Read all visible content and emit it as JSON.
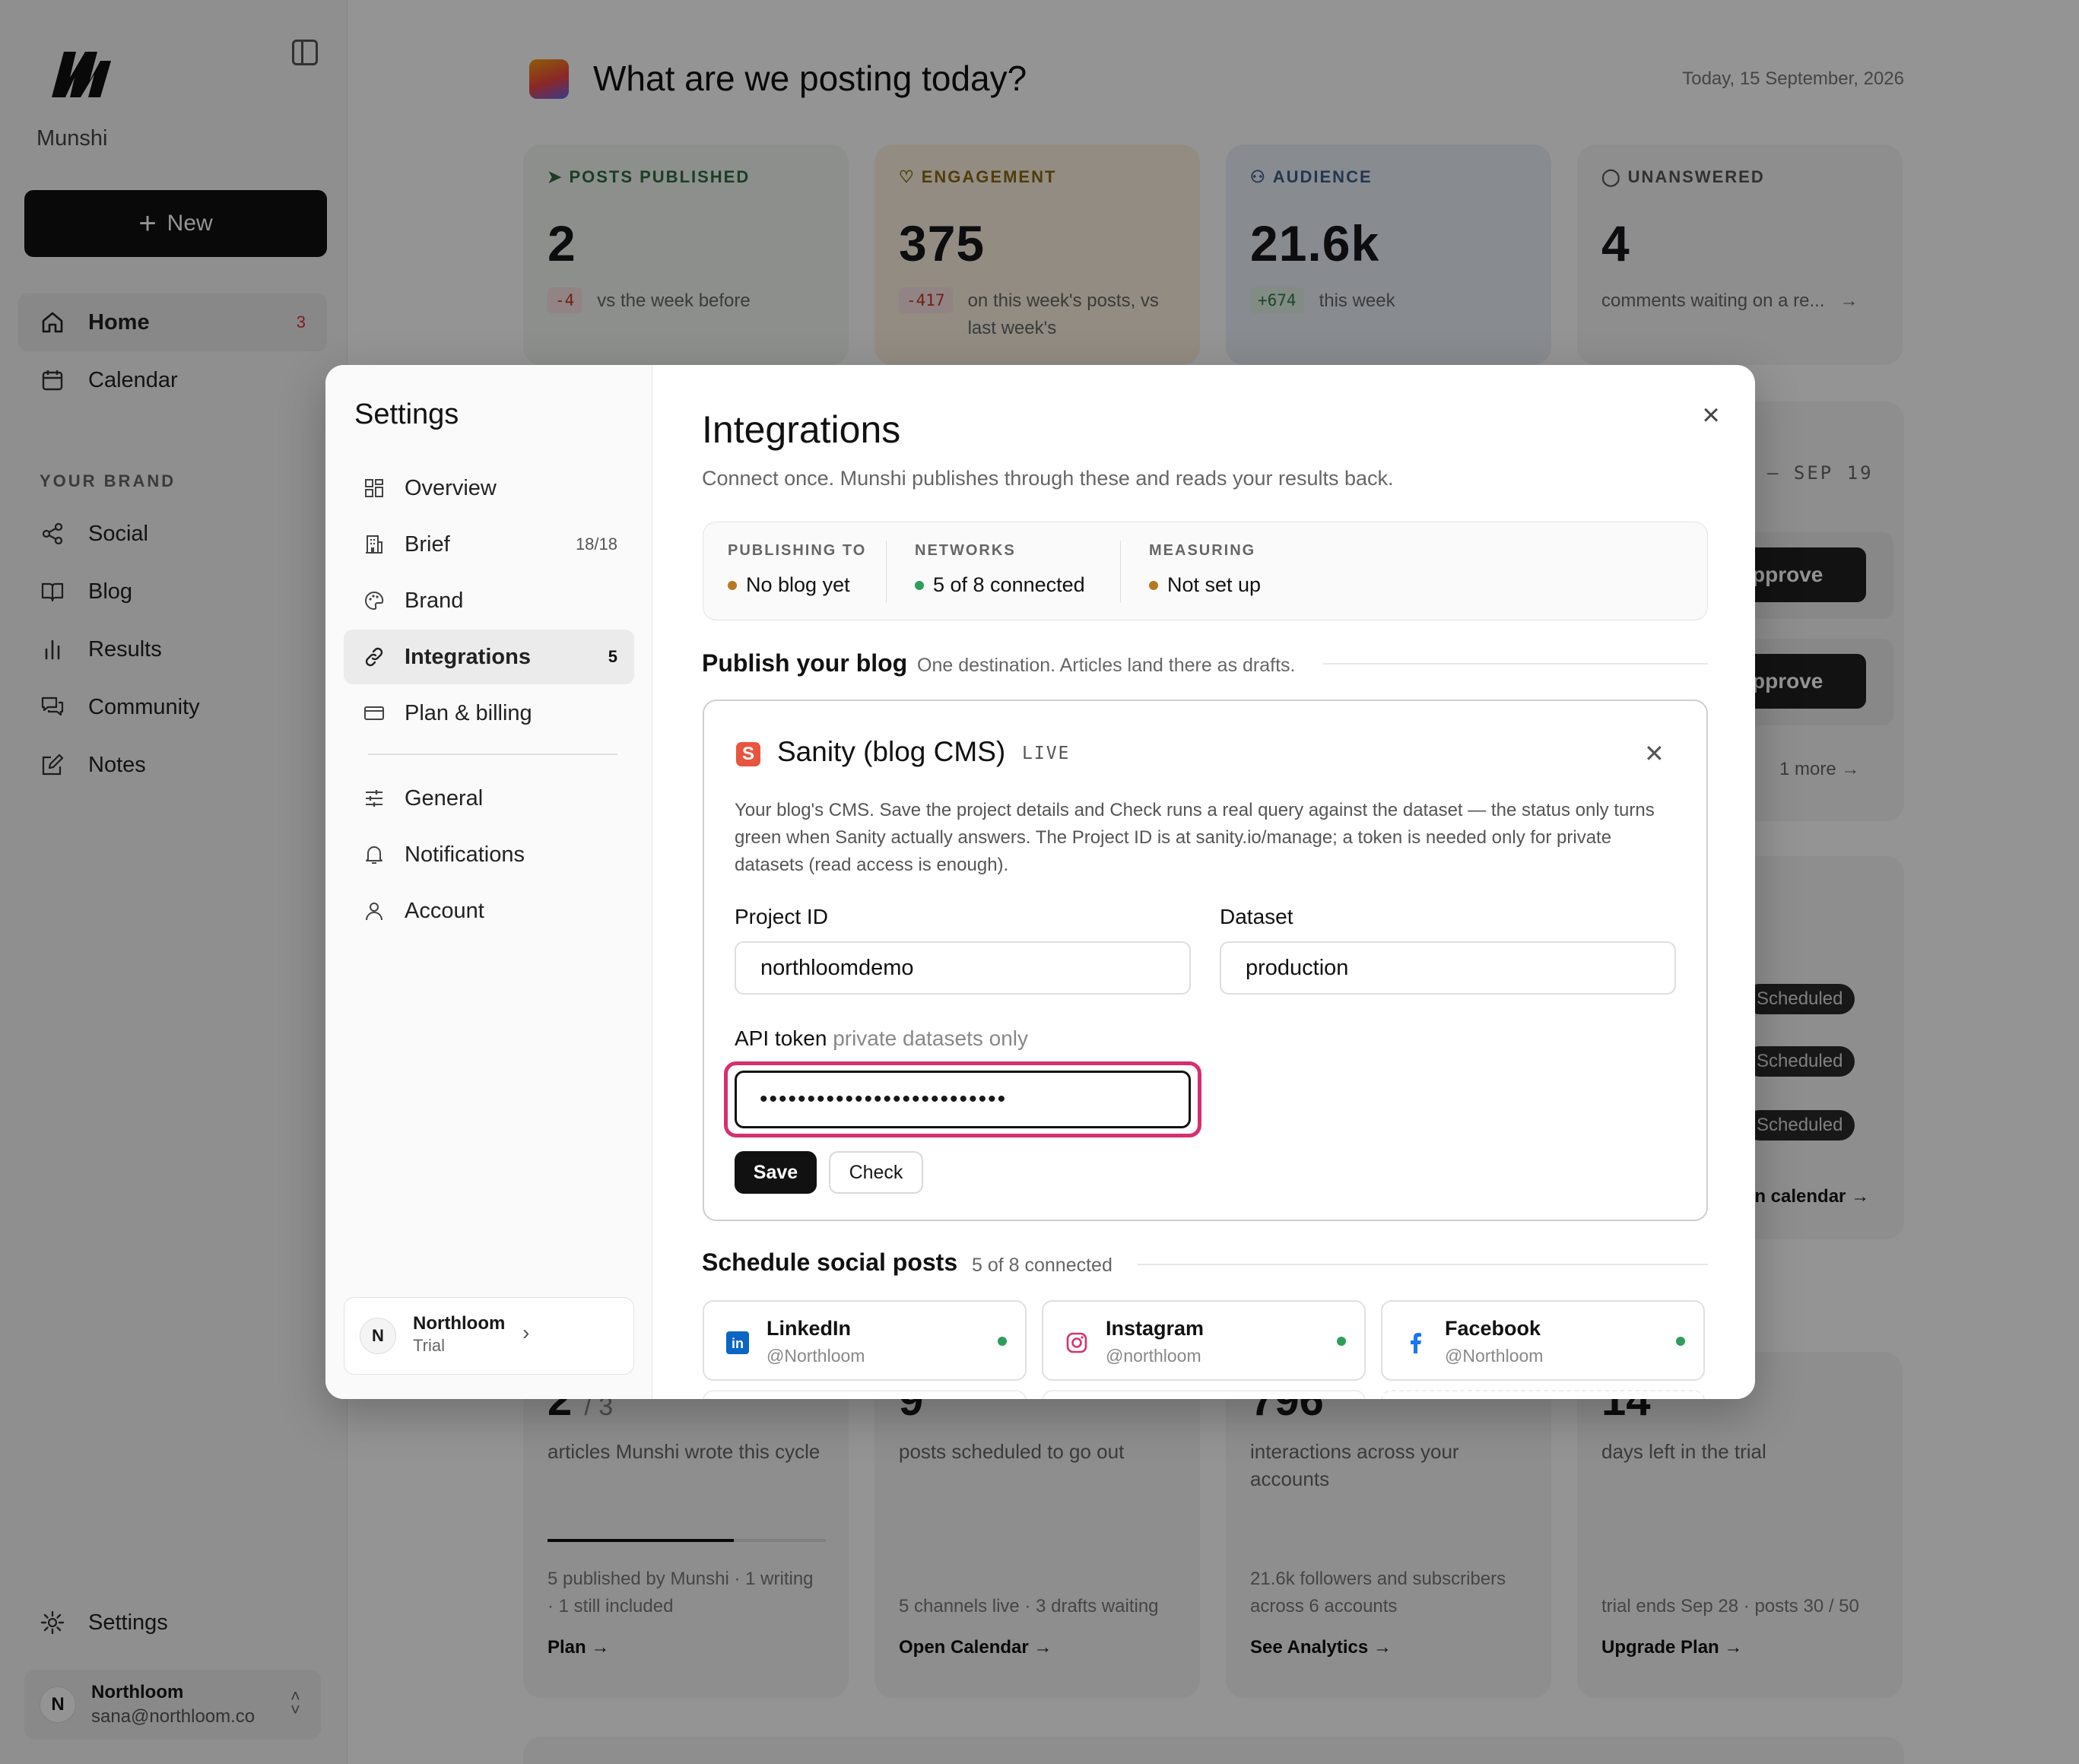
{
  "app": {
    "name": "Munshi",
    "new_label": "New"
  },
  "sidebar": {
    "nav": [
      {
        "label": "Home",
        "badge": "3",
        "icon": "home-icon"
      },
      {
        "label": "Calendar",
        "icon": "calendar-icon"
      }
    ],
    "brand_section": "YOUR BRAND",
    "brand_items": [
      {
        "label": "Social",
        "icon": "share-icon"
      },
      {
        "label": "Blog",
        "icon": "book-icon"
      },
      {
        "label": "Results",
        "icon": "bar-chart-icon"
      },
      {
        "label": "Community",
        "icon": "chat-icon"
      },
      {
        "label": "Notes",
        "icon": "edit-icon"
      }
    ],
    "settings_label": "Settings",
    "user": {
      "initial": "N",
      "name": "Northloom",
      "email": "sana@northloom.co"
    }
  },
  "main": {
    "title": "What are we posting today?",
    "date": "Today, 15 September, 2026",
    "stats": [
      {
        "label": "POSTS PUBLISHED",
        "value": "2",
        "delta": "-4",
        "note": "vs the week before",
        "color": "#2f6b3f"
      },
      {
        "label": "ENGAGEMENT",
        "value": "375",
        "delta": "-417",
        "note": "on this week's posts, vs last week's",
        "color": "#8a6a14"
      },
      {
        "label": "AUDIENCE",
        "value": "21.6k",
        "delta": "+674",
        "note": "this week",
        "color": "#3e5f8a"
      },
      {
        "label": "UNANSWERED",
        "value": "4",
        "note": "comments waiting on a re...",
        "color": "#555555"
      }
    ],
    "behind": {
      "range": "– SEP 19",
      "approve_label": "pprove",
      "more": "1 more",
      "scheduled_label": "Scheduled",
      "calendar_link": "en calendar →"
    },
    "bottom_stats": [
      {
        "big": "2",
        "of": "/ 3",
        "desc": "articles Munshi wrote this cycle",
        "progress": 0.67,
        "foot": "5 published by Munshi · 1 writing · 1 still included",
        "link": "Plan →"
      },
      {
        "big": "9",
        "desc": "posts scheduled to go out",
        "foot": "5 channels live · 3 drafts waiting",
        "link": "Open Calendar →"
      },
      {
        "big": "796",
        "desc": "interactions across your accounts",
        "foot": "21.6k followers and subscribers across 6 accounts",
        "link": "See Analytics →"
      },
      {
        "big": "14",
        "desc": "days left in the trial",
        "foot": "trial ends Sep 28 · posts 30 / 50",
        "link": "Upgrade Plan →"
      }
    ]
  },
  "modal": {
    "title": "Settings",
    "nav": [
      {
        "label": "Overview",
        "icon": "grid-icon"
      },
      {
        "label": "Brief",
        "count": "18/18",
        "icon": "building-icon"
      },
      {
        "label": "Brand",
        "icon": "palette-icon"
      },
      {
        "label": "Integrations",
        "count": "5",
        "icon": "link-icon"
      },
      {
        "label": "Plan & billing",
        "icon": "card-icon"
      },
      {
        "label": "General",
        "icon": "sliders-icon"
      },
      {
        "label": "Notifications",
        "icon": "bell-icon"
      },
      {
        "label": "Account",
        "icon": "user-icon"
      }
    ],
    "org": {
      "initial": "N",
      "name": "Northloom",
      "plan": "Trial"
    },
    "integrations": {
      "title": "Integrations",
      "subtitle": "Connect once. Munshi publishes through these and reads your results back.",
      "summary": [
        {
          "label": "PUBLISHING TO",
          "value": "No blog yet",
          "dot": "#b7791f"
        },
        {
          "label": "NETWORKS",
          "value": "5 of 8 connected",
          "dot": "#2e9e5b"
        },
        {
          "label": "MEASURING",
          "value": "Not set up",
          "dot": "#b7791f"
        }
      ],
      "blog_heading": "Publish your blog",
      "blog_note": "One destination. Articles land there as drafts.",
      "cms": {
        "logo": "S",
        "name": "Sanity (blog CMS)",
        "tag": "LIVE",
        "desc": "Your blog's CMS. Save the project details and Check runs a real query against the dataset — the status only turns green when Sanity actually answers. The Project ID is at sanity.io/manage; a token is needed only for private datasets (read access is enough).",
        "project_label": "Project ID",
        "project_value": "northloomdemo",
        "dataset_label": "Dataset",
        "dataset_value": "production",
        "token_label": "API token",
        "token_hint": "private datasets only",
        "token_value": "••••••••••••••••••••••••••",
        "save": "Save",
        "check": "Check"
      },
      "social_heading": "Schedule social posts",
      "social_note": "5 of 8 connected",
      "socials": [
        {
          "name": "LinkedIn",
          "handle": "@Northloom",
          "icon": "linkedin-icon",
          "color": "#0a66c2"
        },
        {
          "name": "Instagram",
          "handle": "@northloom",
          "icon": "instagram-icon",
          "color": "#d6336c"
        },
        {
          "name": "Facebook",
          "handle": "@Northloom",
          "icon": "facebook-icon",
          "color": "#1877f2"
        }
      ]
    }
  }
}
